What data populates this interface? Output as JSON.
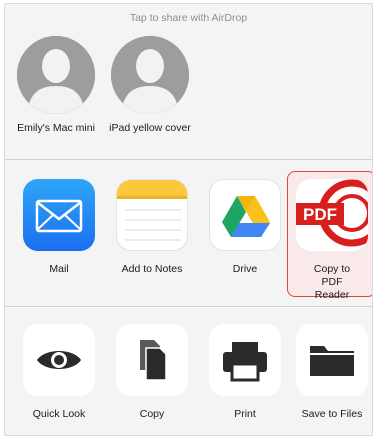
{
  "airdrop": {
    "header": "Tap to share with AirDrop",
    "people": [
      {
        "name": "Emily's Mac mini",
        "icon": "person-silhouette-icon"
      },
      {
        "name": "iPad yellow cover",
        "icon": "person-silhouette-icon"
      }
    ]
  },
  "apps": [
    {
      "label": "Mail",
      "icon": "mail-envelope-icon"
    },
    {
      "label": "Add to Notes",
      "icon": "notes-icon"
    },
    {
      "label": "Drive",
      "icon": "google-drive-icon"
    },
    {
      "label": "Copy to PDF Reader",
      "icon_text": "PDF",
      "icon": "pdf-reader-icon",
      "highlighted": true
    }
  ],
  "actions": [
    {
      "label": "Quick Look",
      "icon": "eye-icon"
    },
    {
      "label": "Copy",
      "icon": "copy-documents-icon"
    },
    {
      "label": "Print",
      "icon": "printer-icon"
    },
    {
      "label": "Save to Files",
      "icon": "folder-icon"
    }
  ],
  "colors": {
    "highlight_border": "#d94a3f",
    "pdf_red": "#d7201e",
    "mail_blue": "#1b6ff0"
  }
}
